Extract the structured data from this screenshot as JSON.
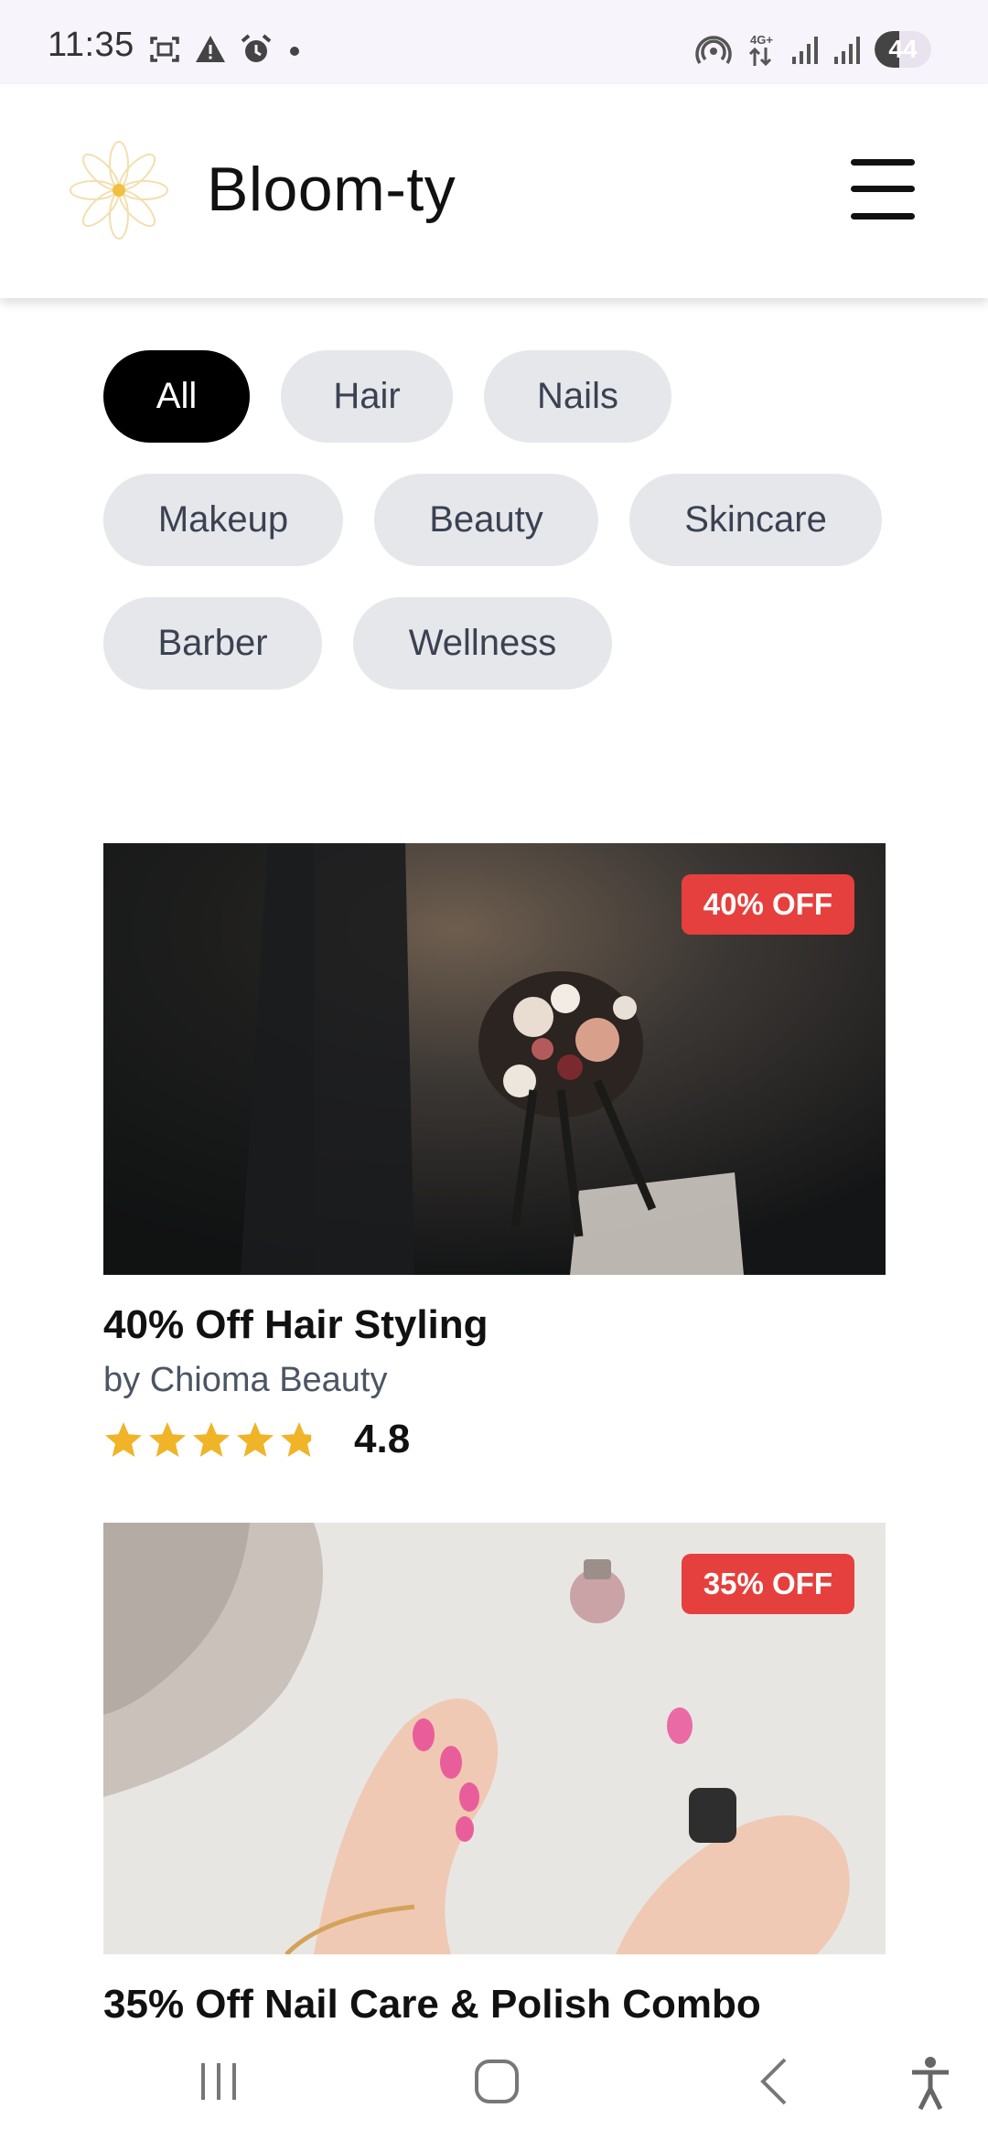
{
  "status_bar": {
    "time": "11:35",
    "battery_level": "44",
    "network": "4G+",
    "icons": [
      "screenshot-icon",
      "warning-icon",
      "alarm-icon",
      "dot-icon",
      "hotspot-icon",
      "data-arrows-icon",
      "signal-icon",
      "signal-icon",
      "battery-icon"
    ]
  },
  "header": {
    "brand": "Bloom-ty",
    "logo_icon": "flower-logo-icon",
    "menu_icon": "hamburger-menu-icon"
  },
  "categories": [
    {
      "label": "All",
      "active": true
    },
    {
      "label": "Hair",
      "active": false
    },
    {
      "label": "Nails",
      "active": false
    },
    {
      "label": "Makeup",
      "active": false
    },
    {
      "label": "Beauty",
      "active": false
    },
    {
      "label": "Skincare",
      "active": false
    },
    {
      "label": "Barber",
      "active": false
    },
    {
      "label": "Wellness",
      "active": false
    }
  ],
  "deals": [
    {
      "badge": "40% OFF",
      "title": "40% Off Hair Styling",
      "provider": "by Chioma Beauty",
      "rating": "4.8",
      "rating_value": 4.8,
      "image": "bridal bouquet photo"
    },
    {
      "badge": "35% OFF",
      "title": "35% Off Nail Care & Polish Combo",
      "image": "pink nail polish manicure photo"
    }
  ],
  "colors": {
    "accent_red": "#e5403d",
    "star_gold": "#f0b429",
    "chip_bg": "#e6e7eb",
    "chip_active": "#000000"
  },
  "nav_bar": {
    "buttons": [
      "recent-apps-icon",
      "home-icon",
      "back-icon",
      "accessibility-icon"
    ]
  }
}
